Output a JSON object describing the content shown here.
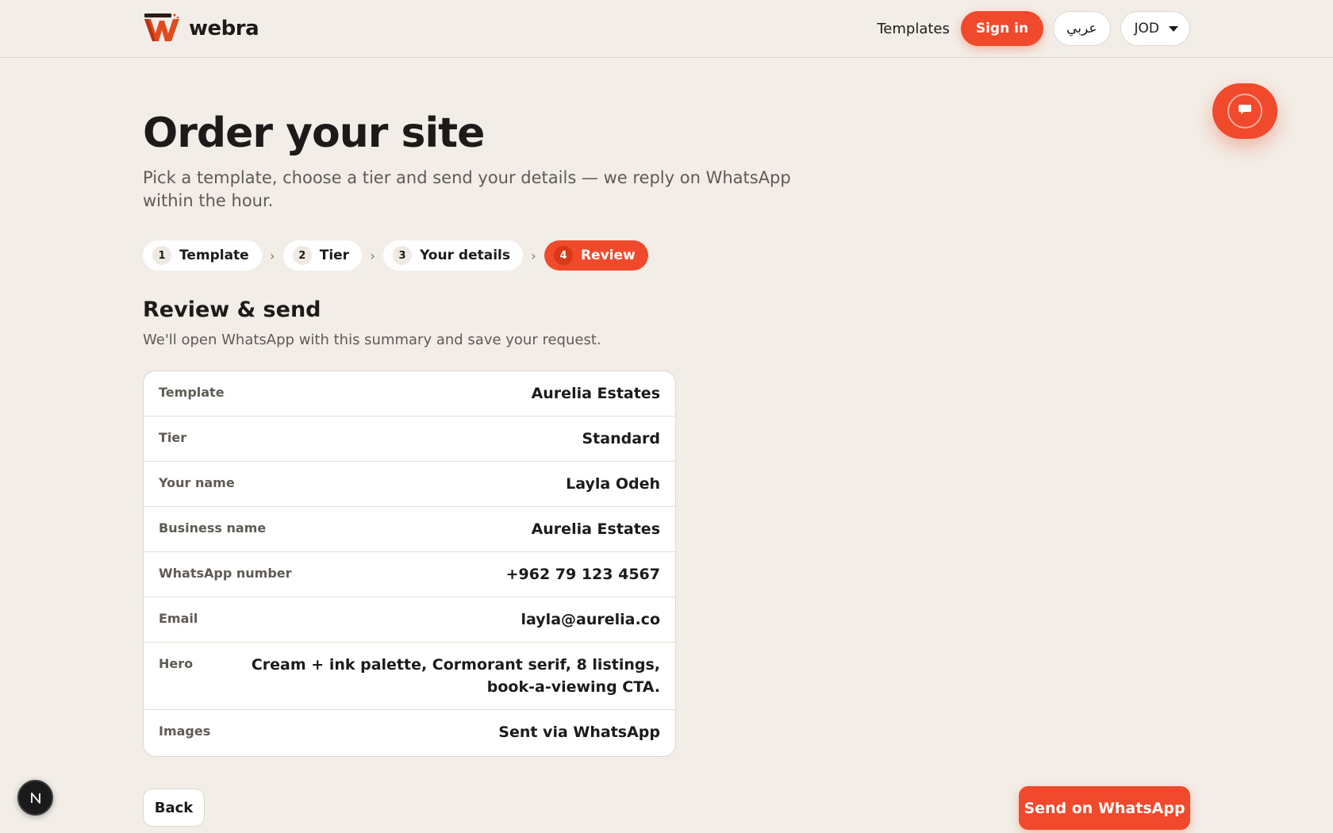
{
  "header": {
    "brand": "webra",
    "nav_templates": "Templates",
    "sign_in": "Sign in",
    "language": "عربي",
    "currency": "JOD"
  },
  "page": {
    "title": "Order your site",
    "subtitle": "Pick a template, choose a tier and send your details — we reply on WhatsApp within the hour."
  },
  "steps": [
    {
      "num": "1",
      "label": "Template",
      "active": false
    },
    {
      "num": "2",
      "label": "Tier",
      "active": false
    },
    {
      "num": "3",
      "label": "Your details",
      "active": false
    },
    {
      "num": "4",
      "label": "Review",
      "active": true
    }
  ],
  "step_separator": "›",
  "review": {
    "title": "Review & send",
    "subtitle": "We'll open WhatsApp with this summary and save your request.",
    "rows": [
      {
        "label": "Template",
        "value": "Aurelia Estates"
      },
      {
        "label": "Tier",
        "value": "Standard"
      },
      {
        "label": "Your name",
        "value": "Layla Odeh"
      },
      {
        "label": "Business name",
        "value": "Aurelia Estates"
      },
      {
        "label": "WhatsApp number",
        "value": "+962 79 123 4567"
      },
      {
        "label": "Email",
        "value": "layla@aurelia.co"
      },
      {
        "label": "Hero",
        "value": "Cream + ink palette, Cormorant serif, 8 listings, book-a-viewing CTA."
      },
      {
        "label": "Images",
        "value": "Sent via WhatsApp"
      }
    ]
  },
  "actions": {
    "back": "Back",
    "send": "Send on WhatsApp"
  },
  "badge": {
    "letter": "N"
  },
  "colors": {
    "accent": "#f0492b",
    "background": "#f2eee7",
    "text": "#1d1b19",
    "muted": "#5f5a53"
  },
  "icons": {
    "chat": "chat-bubble-icon",
    "caret": "caret-down-icon",
    "logo": "webra-logo-icon"
  }
}
